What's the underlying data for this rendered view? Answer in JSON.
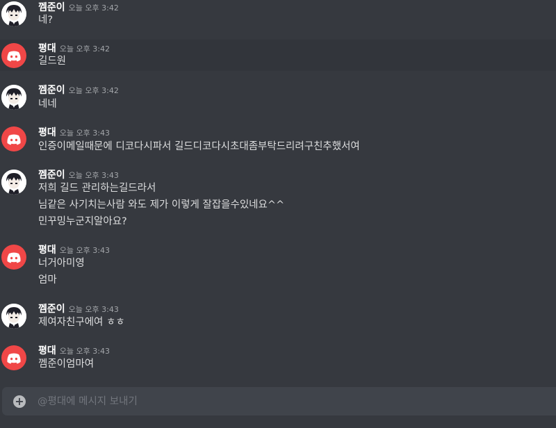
{
  "messages": [
    {
      "author": "껨준이",
      "time": "오늘 오후 3:42",
      "lines": [
        "네?"
      ]
    },
    {
      "author": "평대",
      "time": "오늘 오후 3:42",
      "lines": [
        "길드원"
      ]
    },
    {
      "author": "껨준이",
      "time": "오늘 오후 3:42",
      "lines": [
        "네네"
      ]
    },
    {
      "author": "평대",
      "time": "오늘 오후 3:43",
      "lines": [
        "인증이메일때문에 디코다시파서 길드디코다시초대좀부탁드리려구친추했서여"
      ]
    },
    {
      "author": "껨준이",
      "time": "오늘 오후 3:43",
      "lines": [
        "저희 길드 관리하는길드라서",
        "님같은 사기치는사람 와도 제가 이렇게 잘잡을수있네요^^",
        "민꾸밍누군지알아요?"
      ]
    },
    {
      "author": "평대",
      "time": "오늘 오후 3:43",
      "lines": [
        "너거아미영",
        "엄마"
      ]
    },
    {
      "author": "껨준이",
      "time": "오늘 오후 3:43",
      "lines": [
        "제여자친구에여 ㅎㅎ"
      ]
    },
    {
      "author": "평대",
      "time": "오늘 오후 3:43",
      "lines": [
        "껨준이엄마여"
      ]
    }
  ],
  "composer": {
    "placeholder": "@평대에 메시지 보내기",
    "attach_icon": "plus-circle-icon"
  },
  "colors": {
    "background": "#36393f",
    "highlight_row": "#32353b",
    "composer_bg": "#40444b",
    "bot_avatar": "#f04747",
    "username": "#ffffff",
    "message_text": "#dcddde",
    "timestamp": "#a3a6aa"
  }
}
